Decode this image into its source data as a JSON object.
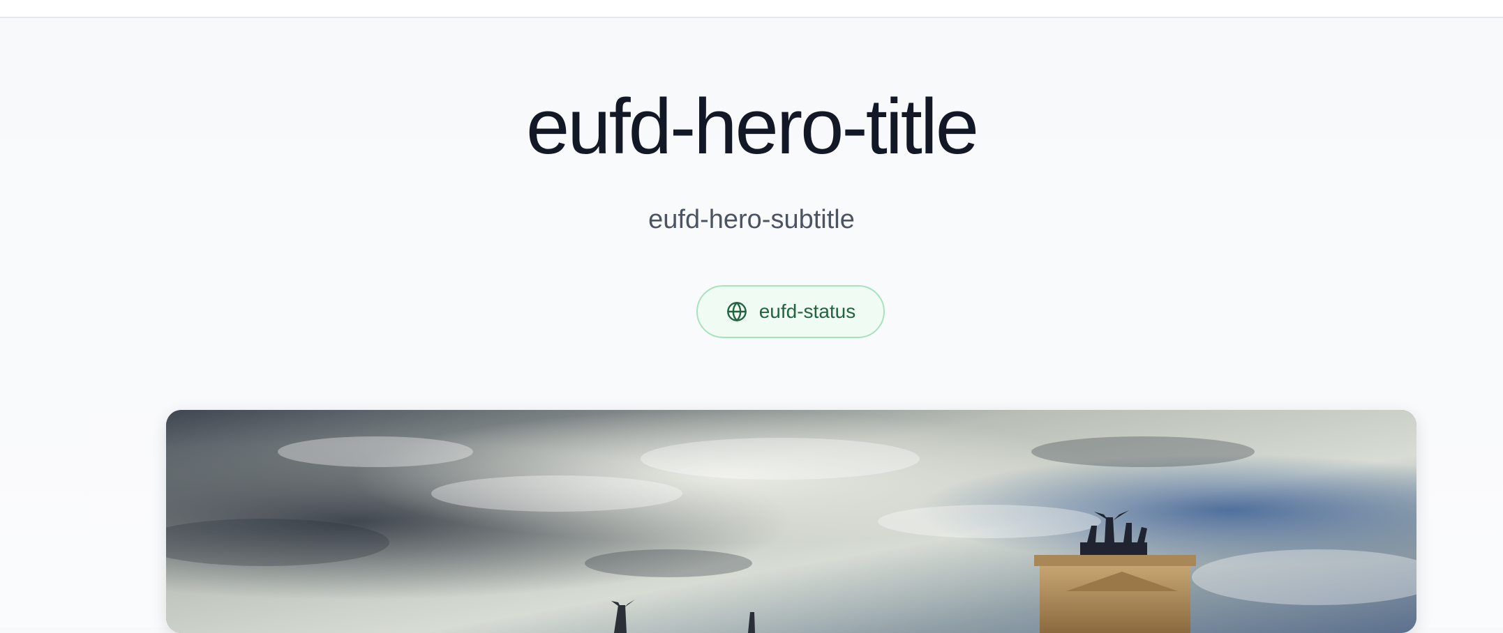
{
  "hero": {
    "title": "eufd-hero-title",
    "subtitle": "eufd-hero-subtitle",
    "status_label": "eufd-status",
    "status_icon": "globe-icon"
  },
  "colors": {
    "title": "#121826",
    "subtitle": "#4b5463",
    "status_text": "#24633f",
    "status_bg": "#effbf3",
    "status_border": "#a8e2bd",
    "page_bg": "#f8f9fb"
  }
}
